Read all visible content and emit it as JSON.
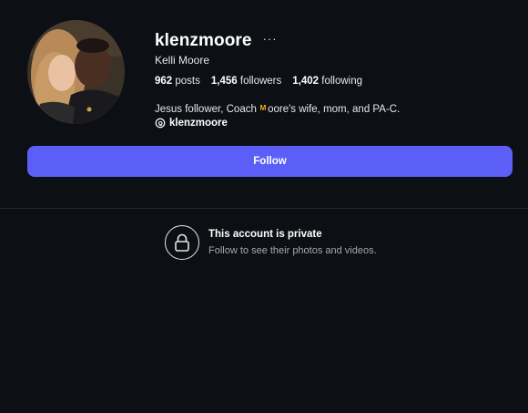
{
  "profile": {
    "username": "klenzmoore",
    "full_name": "Kelli Moore",
    "more_icon": "···",
    "stats": {
      "posts_count": "962",
      "posts_label": "posts",
      "followers_count": "1,456",
      "followers_label": "followers",
      "following_count": "1,402",
      "following_label": "following"
    },
    "bio": {
      "before": "Jesus follower, Coach",
      "emoji": "ᴹ",
      "after": "oore's wife, mom, and PA-C."
    },
    "threads_handle": "klenzmoore"
  },
  "actions": {
    "follow_label": "Follow"
  },
  "private_notice": {
    "title": "This account is private",
    "subtitle": "Follow to see their photos and videos."
  },
  "colors": {
    "background": "#0c0f14",
    "follow_button": "#5b5ff8",
    "emoji_accent": "#f2b21b"
  }
}
